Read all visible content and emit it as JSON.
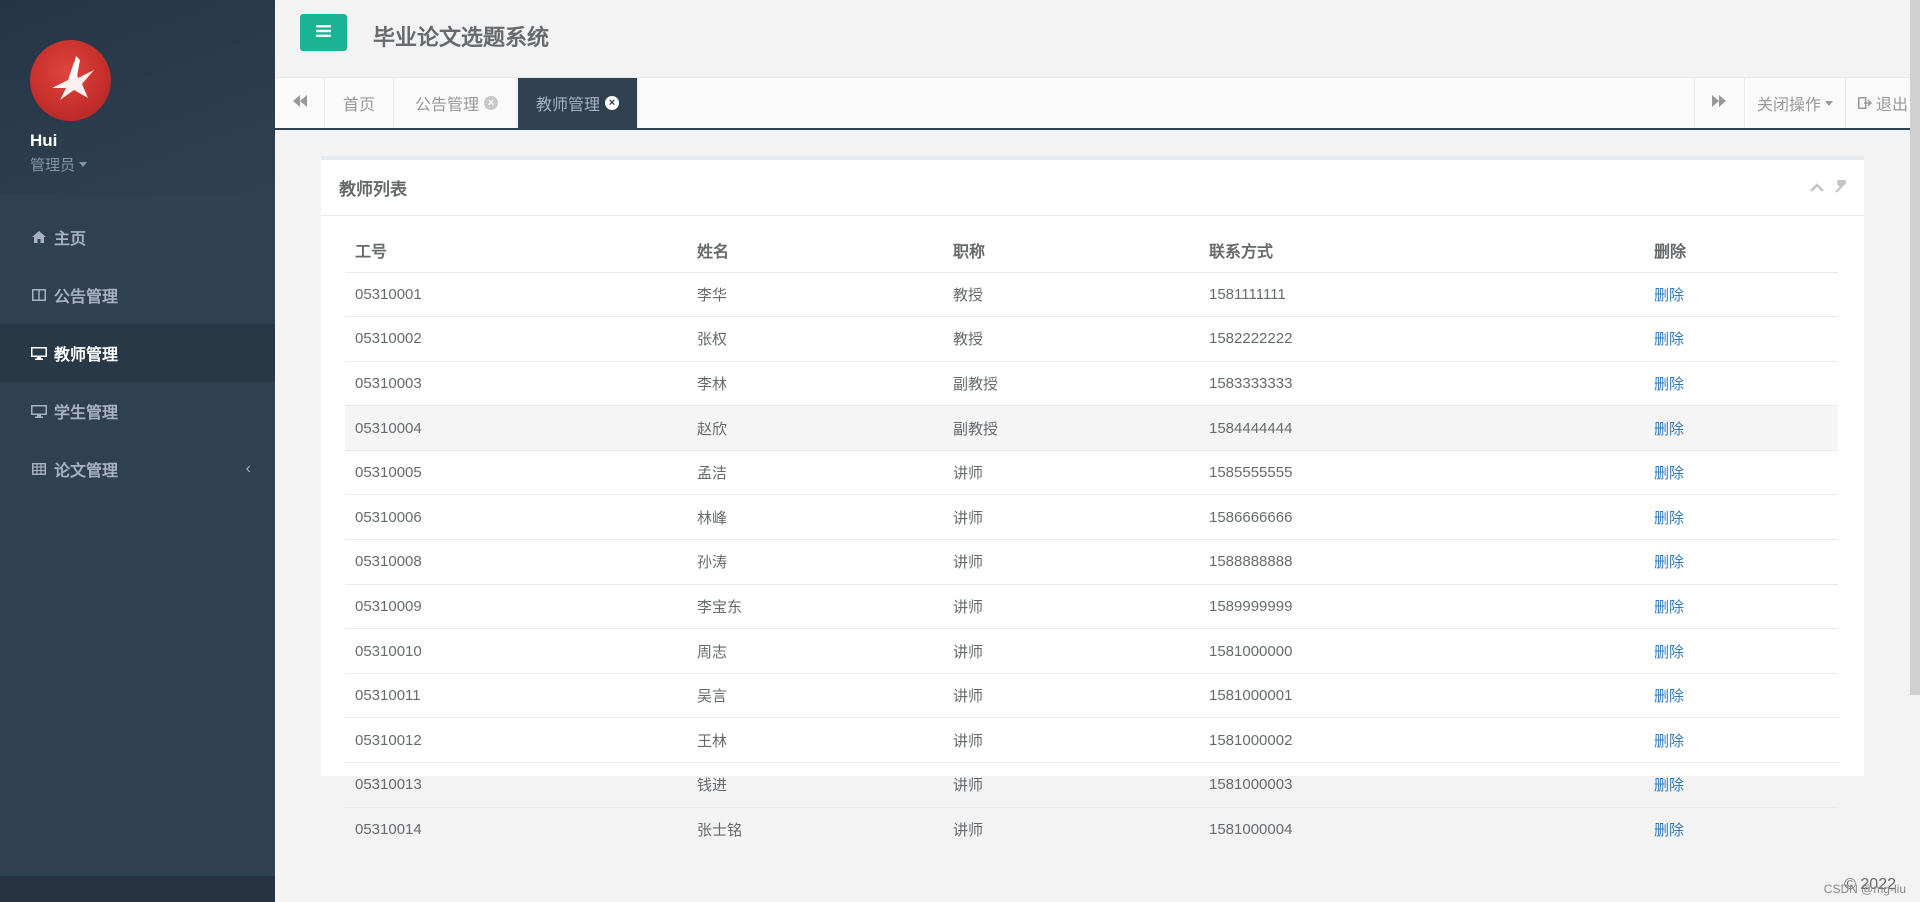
{
  "app": {
    "title": "毕业论文选题系统"
  },
  "colors": {
    "sidebar": "#2f4050",
    "accent": "#1ab394",
    "link": "#337ab7"
  },
  "profile": {
    "name": "Hui",
    "role": "管理员"
  },
  "sidebar": {
    "items": [
      {
        "label": "主页",
        "icon": "home-icon"
      },
      {
        "label": "公告管理",
        "icon": "columns-icon"
      },
      {
        "label": "教师管理",
        "icon": "desktop-icon"
      },
      {
        "label": "学生管理",
        "icon": "desktop-icon"
      },
      {
        "label": "论文管理",
        "icon": "table-icon"
      }
    ]
  },
  "tabs": [
    {
      "label": "首页"
    },
    {
      "label": "公告管理"
    },
    {
      "label": "教师管理"
    }
  ],
  "tools": {
    "close_ops": "关闭操作",
    "logout": "退出"
  },
  "panel": {
    "title": "教师列表"
  },
  "table": {
    "headers": [
      "工号",
      "姓名",
      "职称",
      "联系方式",
      "删除"
    ],
    "delete_label": "删除",
    "rows": [
      [
        "05310001",
        "李华",
        "教授",
        "1581111111"
      ],
      [
        "05310002",
        "张权",
        "教授",
        "1582222222"
      ],
      [
        "05310003",
        "李林",
        "副教授",
        "1583333333"
      ],
      [
        "05310004",
        "赵欣",
        "副教授",
        "1584444444"
      ],
      [
        "05310005",
        "孟洁",
        "讲师",
        "1585555555"
      ],
      [
        "05310006",
        "林峰",
        "讲师",
        "1586666666"
      ],
      [
        "05310008",
        "孙涛",
        "讲师",
        "1588888888"
      ],
      [
        "05310009",
        "李宝东",
        "讲师",
        "1589999999"
      ],
      [
        "05310010",
        "周志",
        "讲师",
        "1581000000"
      ],
      [
        "05310011",
        "吴言",
        "讲师",
        "1581000001"
      ],
      [
        "05310012",
        "王林",
        "讲师",
        "1581000002"
      ],
      [
        "05310013",
        "钱进",
        "讲师",
        "1581000003"
      ],
      [
        "05310014",
        "张士铭",
        "讲师",
        "1581000004"
      ]
    ]
  },
  "footer": {
    "copyright": "© 2022",
    "watermark": "CSDN @mg-liu"
  }
}
